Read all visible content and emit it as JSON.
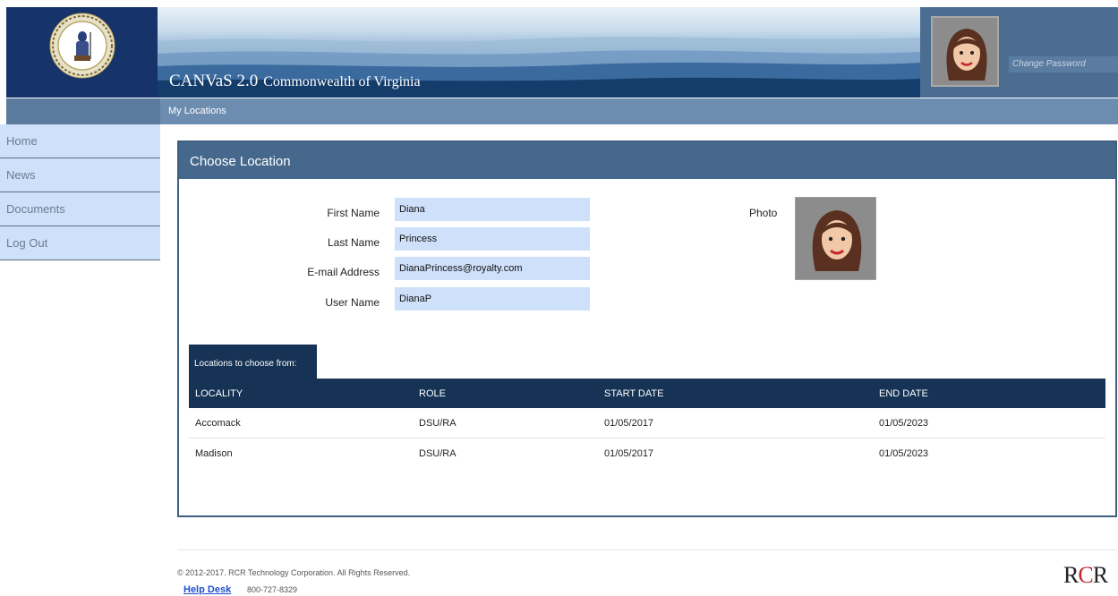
{
  "header": {
    "app_name": "CANVaS 2.0",
    "app_subtitle": "Commonwealth of Virginia",
    "change_password": "Change Password",
    "logo_icon": "virginia-seal-icon",
    "avatar_icon": "user-avatar-icon"
  },
  "navbar": {
    "breadcrumb": "My Locations"
  },
  "sidebar": {
    "items": [
      {
        "label": "Home"
      },
      {
        "label": "News"
      },
      {
        "label": "Documents"
      },
      {
        "label": "Log Out"
      }
    ]
  },
  "panel": {
    "title": "Choose Location",
    "fields": [
      {
        "label": "First Name",
        "value": "Diana"
      },
      {
        "label": "Last Name",
        "value": "Princess"
      },
      {
        "label": "E-mail Address",
        "value": "DianaPrincess@royalty.com"
      },
      {
        "label": "User Name",
        "value": "DianaP"
      }
    ],
    "photo_label": "Photo",
    "locations_tab": "Locations to choose from:",
    "table": {
      "columns": [
        "LOCALITY",
        "ROLE",
        "START DATE",
        "END DATE"
      ],
      "rows": [
        [
          "Accomack",
          "DSU/RA",
          "01/05/2017",
          "01/05/2023"
        ],
        [
          "Madison",
          "DSU/RA",
          "01/05/2017",
          "01/05/2023"
        ]
      ]
    }
  },
  "footer": {
    "copyright": "© 2012-2017. RCR Technology Corporation. All Rights Reserved.",
    "help_desk": "Help Desk",
    "phone": "800-727-8329",
    "logo_left": "R",
    "logo_mid": "C",
    "logo_right": "R"
  },
  "colors": {
    "header_navy": "#16336a",
    "panel_header": "#46688c",
    "table_header": "#163355",
    "field_bg": "#cfe0fa",
    "link_blue": "#1f4fd1"
  }
}
